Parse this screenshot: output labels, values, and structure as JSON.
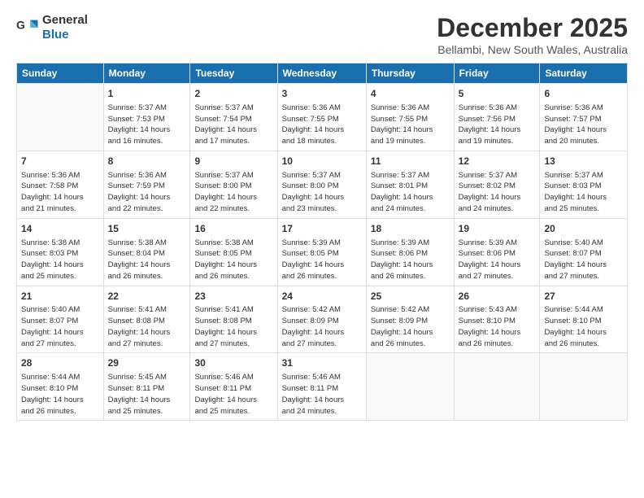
{
  "app": {
    "name_general": "General",
    "name_blue": "Blue"
  },
  "header": {
    "title": "December 2025",
    "subtitle": "Bellambi, New South Wales, Australia"
  },
  "calendar": {
    "weekdays": [
      "Sunday",
      "Monday",
      "Tuesday",
      "Wednesday",
      "Thursday",
      "Friday",
      "Saturday"
    ],
    "weeks": [
      [
        {
          "day": "",
          "info": ""
        },
        {
          "day": "1",
          "info": "Sunrise: 5:37 AM\nSunset: 7:53 PM\nDaylight: 14 hours\nand 16 minutes."
        },
        {
          "day": "2",
          "info": "Sunrise: 5:37 AM\nSunset: 7:54 PM\nDaylight: 14 hours\nand 17 minutes."
        },
        {
          "day": "3",
          "info": "Sunrise: 5:36 AM\nSunset: 7:55 PM\nDaylight: 14 hours\nand 18 minutes."
        },
        {
          "day": "4",
          "info": "Sunrise: 5:36 AM\nSunset: 7:55 PM\nDaylight: 14 hours\nand 19 minutes."
        },
        {
          "day": "5",
          "info": "Sunrise: 5:36 AM\nSunset: 7:56 PM\nDaylight: 14 hours\nand 19 minutes."
        },
        {
          "day": "6",
          "info": "Sunrise: 5:36 AM\nSunset: 7:57 PM\nDaylight: 14 hours\nand 20 minutes."
        }
      ],
      [
        {
          "day": "7",
          "info": "Sunrise: 5:36 AM\nSunset: 7:58 PM\nDaylight: 14 hours\nand 21 minutes."
        },
        {
          "day": "8",
          "info": "Sunrise: 5:36 AM\nSunset: 7:59 PM\nDaylight: 14 hours\nand 22 minutes."
        },
        {
          "day": "9",
          "info": "Sunrise: 5:37 AM\nSunset: 8:00 PM\nDaylight: 14 hours\nand 22 minutes."
        },
        {
          "day": "10",
          "info": "Sunrise: 5:37 AM\nSunset: 8:00 PM\nDaylight: 14 hours\nand 23 minutes."
        },
        {
          "day": "11",
          "info": "Sunrise: 5:37 AM\nSunset: 8:01 PM\nDaylight: 14 hours\nand 24 minutes."
        },
        {
          "day": "12",
          "info": "Sunrise: 5:37 AM\nSunset: 8:02 PM\nDaylight: 14 hours\nand 24 minutes."
        },
        {
          "day": "13",
          "info": "Sunrise: 5:37 AM\nSunset: 8:03 PM\nDaylight: 14 hours\nand 25 minutes."
        }
      ],
      [
        {
          "day": "14",
          "info": "Sunrise: 5:38 AM\nSunset: 8:03 PM\nDaylight: 14 hours\nand 25 minutes."
        },
        {
          "day": "15",
          "info": "Sunrise: 5:38 AM\nSunset: 8:04 PM\nDaylight: 14 hours\nand 26 minutes."
        },
        {
          "day": "16",
          "info": "Sunrise: 5:38 AM\nSunset: 8:05 PM\nDaylight: 14 hours\nand 26 minutes."
        },
        {
          "day": "17",
          "info": "Sunrise: 5:39 AM\nSunset: 8:05 PM\nDaylight: 14 hours\nand 26 minutes."
        },
        {
          "day": "18",
          "info": "Sunrise: 5:39 AM\nSunset: 8:06 PM\nDaylight: 14 hours\nand 26 minutes."
        },
        {
          "day": "19",
          "info": "Sunrise: 5:39 AM\nSunset: 8:06 PM\nDaylight: 14 hours\nand 27 minutes."
        },
        {
          "day": "20",
          "info": "Sunrise: 5:40 AM\nSunset: 8:07 PM\nDaylight: 14 hours\nand 27 minutes."
        }
      ],
      [
        {
          "day": "21",
          "info": "Sunrise: 5:40 AM\nSunset: 8:07 PM\nDaylight: 14 hours\nand 27 minutes."
        },
        {
          "day": "22",
          "info": "Sunrise: 5:41 AM\nSunset: 8:08 PM\nDaylight: 14 hours\nand 27 minutes."
        },
        {
          "day": "23",
          "info": "Sunrise: 5:41 AM\nSunset: 8:08 PM\nDaylight: 14 hours\nand 27 minutes."
        },
        {
          "day": "24",
          "info": "Sunrise: 5:42 AM\nSunset: 8:09 PM\nDaylight: 14 hours\nand 27 minutes."
        },
        {
          "day": "25",
          "info": "Sunrise: 5:42 AM\nSunset: 8:09 PM\nDaylight: 14 hours\nand 26 minutes."
        },
        {
          "day": "26",
          "info": "Sunrise: 5:43 AM\nSunset: 8:10 PM\nDaylight: 14 hours\nand 26 minutes."
        },
        {
          "day": "27",
          "info": "Sunrise: 5:44 AM\nSunset: 8:10 PM\nDaylight: 14 hours\nand 26 minutes."
        }
      ],
      [
        {
          "day": "28",
          "info": "Sunrise: 5:44 AM\nSunset: 8:10 PM\nDaylight: 14 hours\nand 26 minutes."
        },
        {
          "day": "29",
          "info": "Sunrise: 5:45 AM\nSunset: 8:11 PM\nDaylight: 14 hours\nand 25 minutes."
        },
        {
          "day": "30",
          "info": "Sunrise: 5:46 AM\nSunset: 8:11 PM\nDaylight: 14 hours\nand 25 minutes."
        },
        {
          "day": "31",
          "info": "Sunrise: 5:46 AM\nSunset: 8:11 PM\nDaylight: 14 hours\nand 24 minutes."
        },
        {
          "day": "",
          "info": ""
        },
        {
          "day": "",
          "info": ""
        },
        {
          "day": "",
          "info": ""
        }
      ]
    ]
  }
}
